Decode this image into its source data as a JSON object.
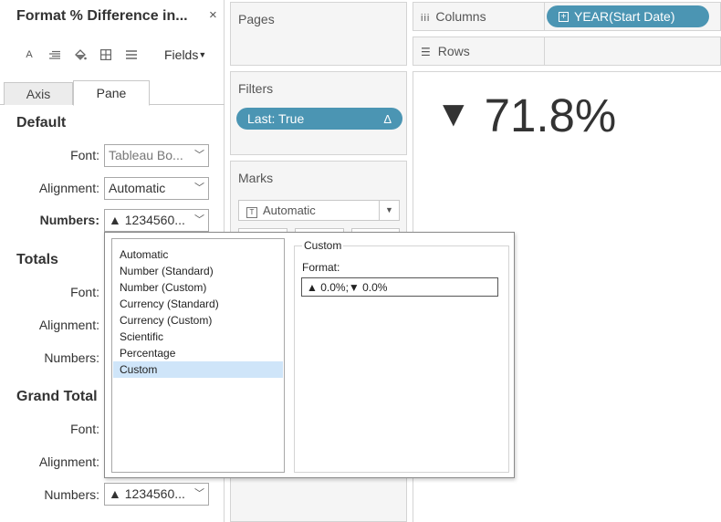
{
  "format_pane": {
    "title": "Format % Difference in...",
    "close": "×",
    "fields_label": "Fields",
    "tabs": [
      "Axis",
      "Pane"
    ],
    "default": {
      "heading": "Default",
      "font_label": "Font:",
      "font_value": "Tableau Bo...",
      "alignment_label": "Alignment:",
      "alignment_value": "Automatic",
      "numbers_label": "Numbers:",
      "numbers_value": "▲ 1234560..."
    },
    "totals": {
      "heading": "Totals",
      "font_label": "Font:",
      "alignment_label": "Alignment:",
      "numbers_label": "Numbers:"
    },
    "grand_totals": {
      "heading": "Grand Total",
      "font_label": "Font:",
      "alignment_label": "Alignment:",
      "numbers_label": "Numbers:",
      "numbers_value": "▲ 1234560..."
    }
  },
  "shelves": {
    "pages_title": "Pages",
    "filters_title": "Filters",
    "filter_pill": "Last: True",
    "filter_pill_icon": "Δ",
    "marks_title": "Marks",
    "marks_type": "Automatic",
    "columns_label": "Columns",
    "columns_pill": "YEAR(Start Date)",
    "rows_label": "Rows"
  },
  "view": {
    "arrow": "▼",
    "value": "71.8%"
  },
  "number_format_popup": {
    "options": [
      "Automatic",
      "Number (Standard)",
      "Number (Custom)",
      "Currency (Standard)",
      "Currency (Custom)",
      "Scientific",
      "Percentage",
      "Custom"
    ],
    "selected": "Custom",
    "group_title": "Custom",
    "format_label": "Format:",
    "format_value": "▲ 0.0%;▼ 0.0%"
  },
  "colors": {
    "pill": "#4b95b3",
    "selection": "#cfe5f9",
    "shelf_bg": "#f5f5f5"
  }
}
